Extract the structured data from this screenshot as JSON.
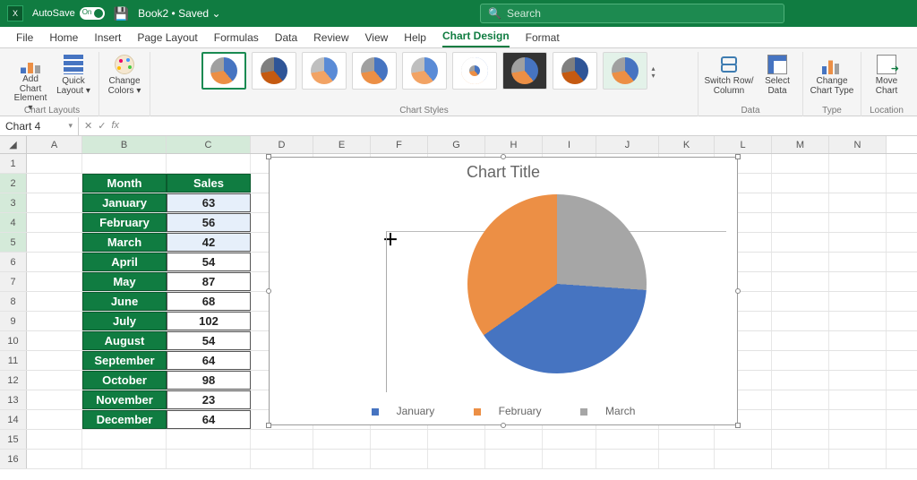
{
  "titlebar": {
    "autosave_label": "AutoSave",
    "autosave_on": "On",
    "doc_name": "Book2",
    "doc_status": "Saved",
    "search_placeholder": "Search"
  },
  "menu": {
    "items": [
      "File",
      "Home",
      "Insert",
      "Page Layout",
      "Formulas",
      "Data",
      "Review",
      "View",
      "Help",
      "Chart Design",
      "Format"
    ],
    "active_index": 9
  },
  "ribbon": {
    "layouts": {
      "add_chart_element": "Add Chart Element ▾",
      "quick_layout": "Quick Layout ▾",
      "group": "Chart Layouts"
    },
    "colors": {
      "change_colors": "Change Colors ▾"
    },
    "styles_group": "Chart Styles",
    "data": {
      "switch": "Switch Row/ Column",
      "select": "Select Data",
      "group": "Data"
    },
    "type": {
      "change": "Change Chart Type",
      "group": "Type"
    },
    "location": {
      "move": "Move Chart",
      "group": "Location"
    }
  },
  "formula_bar": {
    "name_box": "Chart 4",
    "fx": "fx"
  },
  "columns": [
    "A",
    "B",
    "C",
    "D",
    "E",
    "F",
    "G",
    "H",
    "I",
    "J",
    "K",
    "L",
    "M",
    "N"
  ],
  "table": {
    "header": {
      "month": "Month",
      "sales": "Sales"
    },
    "rows": [
      {
        "month": "January",
        "sales": "63",
        "selected": true
      },
      {
        "month": "February",
        "sales": "56",
        "selected": true
      },
      {
        "month": "March",
        "sales": "42",
        "selected": true
      },
      {
        "month": "April",
        "sales": "54",
        "selected": false
      },
      {
        "month": "May",
        "sales": "87",
        "selected": false
      },
      {
        "month": "June",
        "sales": "68",
        "selected": false
      },
      {
        "month": "July",
        "sales": "102",
        "selected": false
      },
      {
        "month": "August",
        "sales": "54",
        "selected": false
      },
      {
        "month": "September",
        "sales": "64",
        "selected": false
      },
      {
        "month": "October",
        "sales": "98",
        "selected": false
      },
      {
        "month": "November",
        "sales": "23",
        "selected": false
      },
      {
        "month": "December",
        "sales": "64",
        "selected": false
      }
    ]
  },
  "chart": {
    "title": "Chart Title",
    "legend": [
      "January",
      "February",
      "March"
    ]
  },
  "chart_data": {
    "type": "pie",
    "title": "Chart Title",
    "categories": [
      "January",
      "February",
      "March"
    ],
    "values": [
      63,
      56,
      42
    ],
    "colors": [
      "#4674c1",
      "#ec8f45",
      "#a6a6a6"
    ],
    "legend_position": "bottom"
  }
}
